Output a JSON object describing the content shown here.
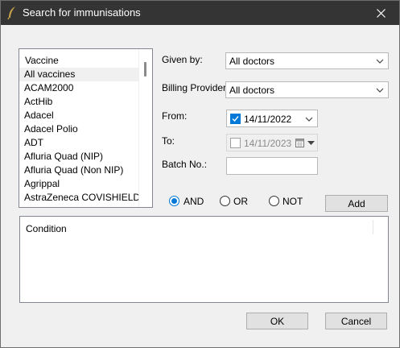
{
  "window": {
    "title": "Search for immunisations",
    "icon": "app-feather-icon",
    "close_icon": "close-icon"
  },
  "vaccine_list": {
    "header": "Vaccine",
    "selected": "All vaccines",
    "items": [
      "All vaccines",
      "ACAM2000",
      "ActHib",
      "Adacel",
      "Adacel Polio",
      "ADT",
      "Afluria Quad (NIP)",
      "Afluria Quad (Non NIP)",
      "Agrippal",
      "AstraZeneca COVISHIELD"
    ]
  },
  "given_by": {
    "label": "Given by:",
    "value": "All doctors"
  },
  "billing_provider": {
    "label": "Billing Provider:",
    "value": "All doctors"
  },
  "from": {
    "label": "From:",
    "value": "14/11/2022",
    "checked": true
  },
  "to": {
    "label": "To:",
    "value": "14/11/2023",
    "checked": false
  },
  "batch": {
    "label": "Batch No.:",
    "value": ""
  },
  "operators": {
    "options": [
      "AND",
      "OR",
      "NOT"
    ],
    "selected": "AND"
  },
  "add_button": "Add",
  "condition": {
    "header": "Condition",
    "rows": []
  },
  "footer": {
    "ok": "OK",
    "cancel": "Cancel"
  },
  "colors": {
    "titlebar": "#343434",
    "accent": "#0078d7",
    "dialog_bg": "#f0f0f0"
  }
}
